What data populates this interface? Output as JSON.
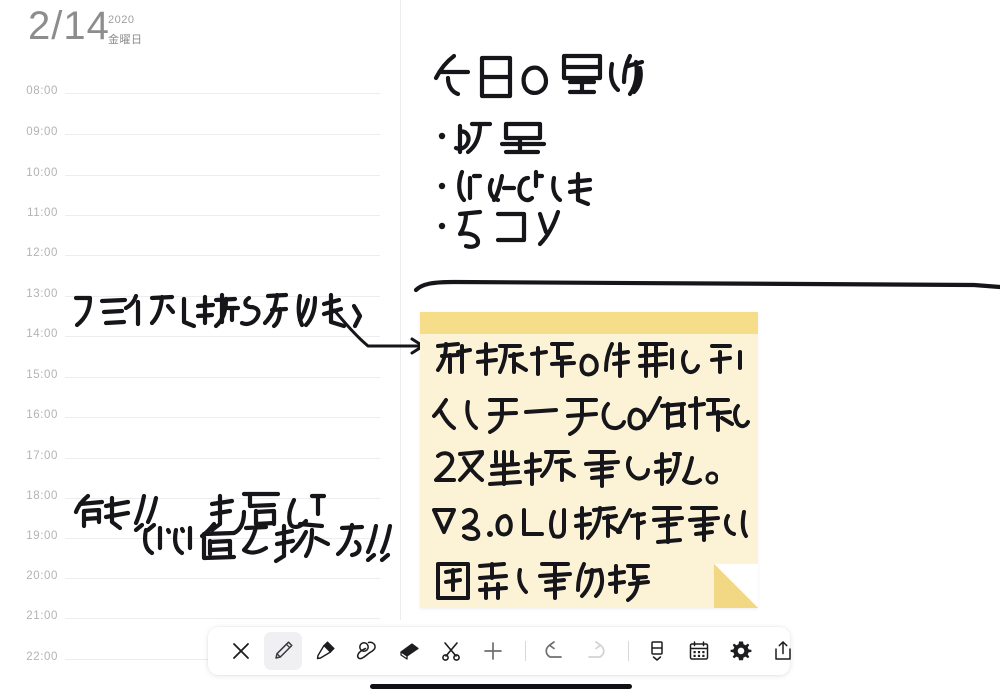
{
  "header": {
    "date": "2/14",
    "year": "2020",
    "weekday": "金曜日"
  },
  "schedule": {
    "time_slots": [
      "08:00",
      "09:00",
      "10:00",
      "11:00",
      "12:00",
      "13:00",
      "14:00",
      "15:00",
      "16:00",
      "17:00",
      "18:00",
      "19:00",
      "20:00",
      "21:00",
      "22:00"
    ],
    "handwritten_entries": [
      {
        "text": "クライアント打ち合わせ",
        "time": "13:00"
      },
      {
        "text": "飲み!! 新宿で",
        "time": "18:00"
      },
      {
        "text": "いい店を探す!!",
        "time": "19:00"
      }
    ]
  },
  "notes_page": {
    "title": "今日の買い物",
    "list_items": [
      "納豆",
      "じゃがいも",
      "5コン"
    ]
  },
  "sticky_note": {
    "color": "#fcf3d6",
    "stripe_color": "#f6dd8a",
    "lines": [
      "新機能の仕様をチェック",
      "インターフェースの確認もし、",
      "改善提案を出す。",
      "∇3.01は動作不安定なので、",
      "開発に要確認"
    ]
  },
  "toolbar": {
    "tools": [
      {
        "name": "close",
        "label": "閉じる",
        "active": false
      },
      {
        "name": "pencil",
        "label": "ペンシル",
        "active": true
      },
      {
        "name": "marker",
        "label": "マーカー",
        "active": false
      },
      {
        "name": "stamp",
        "label": "スタンプ",
        "active": false
      },
      {
        "name": "eraser",
        "label": "消しゴム",
        "active": false
      },
      {
        "name": "scissors",
        "label": "切り取り",
        "active": false
      },
      {
        "name": "add",
        "label": "追加",
        "active": false
      },
      {
        "name": "undo",
        "label": "元に戻す",
        "enabled": true
      },
      {
        "name": "redo",
        "label": "やり直す",
        "enabled": false
      },
      {
        "name": "page-select",
        "label": "ページ",
        "active": false
      },
      {
        "name": "calendar",
        "label": "カレンダー",
        "active": false
      },
      {
        "name": "settings",
        "label": "設定",
        "active": false
      },
      {
        "name": "share",
        "label": "共有",
        "active": false
      }
    ]
  }
}
